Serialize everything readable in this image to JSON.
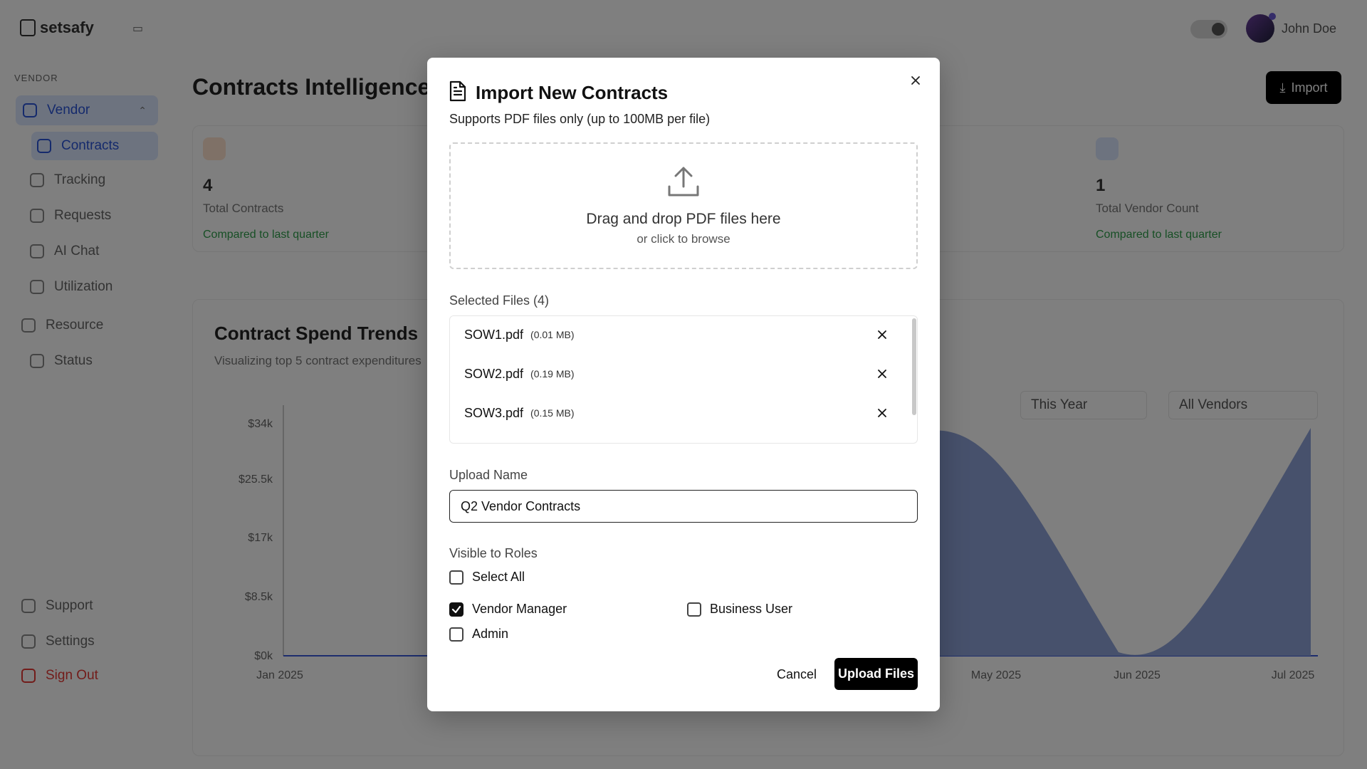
{
  "app": {
    "logo_text": "setsafy",
    "user_name": "John Doe",
    "page_title": "Contracts Intelligence",
    "import_button": "Import",
    "sidebar": {
      "section_label": "VENDOR",
      "vendor": "Vendor",
      "items": [
        "Contracts",
        "Tracking",
        "Requests",
        "AI Chat",
        "Utilization"
      ],
      "resource": "Resource",
      "resource_items": [
        "Status"
      ],
      "footer": [
        "Support",
        "Settings",
        "Sign Out"
      ]
    },
    "stats": [
      {
        "value": "4",
        "label": "Total Contracts",
        "trend": "Compared to last quarter"
      },
      {
        "value": "1",
        "label": "Total Vendor Count",
        "trend": "Compared to last quarter"
      }
    ],
    "chart": {
      "title": "Contract Spend Trends",
      "subtitle": "Visualizing top 5 contract expenditures",
      "filters": [
        "This Year",
        "All Vendors"
      ],
      "y_ticks": [
        "$34k",
        "$25.5k",
        "$17k",
        "$8.5k",
        "$0k"
      ],
      "x_ticks": [
        "Jan 2025",
        "May 2025",
        "Jun 2025",
        "Jul 2025"
      ]
    }
  },
  "modal": {
    "title": "Import New Contracts",
    "subtitle": "Supports PDF files only (up to 100MB per file)",
    "dropzone": {
      "main_text": "Drag and drop PDF files here",
      "hint_text": "or click to browse"
    },
    "selected_files_label": "Selected Files (4)",
    "files": [
      {
        "name": "SOW1.pdf",
        "size": "(0.01 MB)"
      },
      {
        "name": "SOW2.pdf",
        "size": "(0.19 MB)"
      },
      {
        "name": "SOW3.pdf",
        "size": "(0.15 MB)"
      }
    ],
    "upload_name_label": "Upload Name",
    "upload_name_value": "Q2 Vendor Contracts",
    "roles_label": "Visible to Roles",
    "roles": {
      "select_all": {
        "label": "Select All",
        "checked": false
      },
      "vendor_manager": {
        "label": "Vendor Manager",
        "checked": true
      },
      "business_user": {
        "label": "Business User",
        "checked": false
      },
      "admin": {
        "label": "Admin",
        "checked": false
      }
    },
    "cancel_label": "Cancel",
    "upload_label": "Upload Files"
  }
}
